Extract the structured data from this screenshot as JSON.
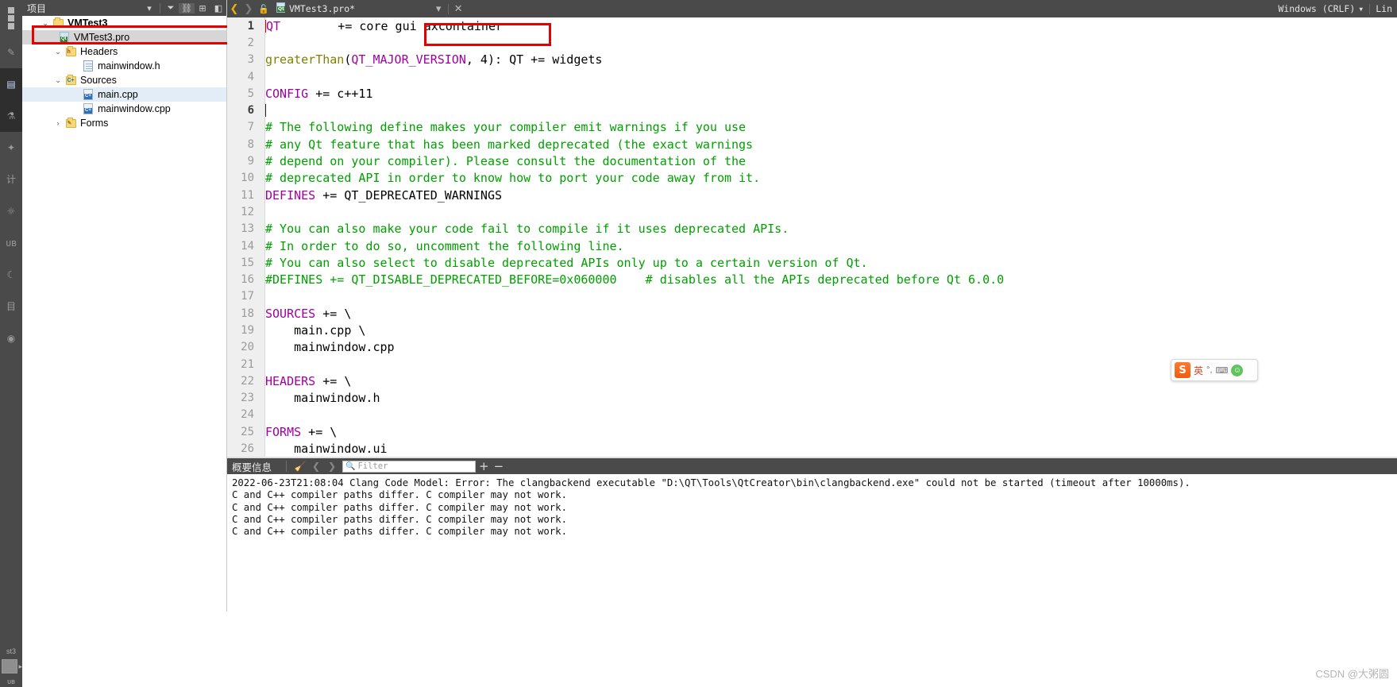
{
  "rail": {
    "items": [
      {
        "name": "welcome",
        "glyph": "▦"
      },
      {
        "name": "edit",
        "glyph": "✎"
      },
      {
        "name": "design",
        "glyph": "◧",
        "active": true
      },
      {
        "name": "debug",
        "glyph": "⚙"
      },
      {
        "name": "projects",
        "glyph": "✦"
      },
      {
        "name": "help",
        "glyph": "计"
      },
      {
        "name": "settings",
        "glyph": "☼"
      },
      {
        "name": "ue",
        "glyph": "ᴜʙ"
      },
      {
        "name": "run",
        "glyph": "☾"
      },
      {
        "name": "project2",
        "glyph": "目"
      },
      {
        "name": "build",
        "glyph": "◉"
      }
    ],
    "bottom_label": "st3",
    "bottom_label2": "ᴜʙ"
  },
  "sidebar": {
    "title": "项目",
    "header_buttons": [
      "▼",
      "filter-icon",
      "link-icon",
      "split-icon"
    ],
    "tree": [
      {
        "label": "VMTest3",
        "icon": "folder",
        "depth": 0,
        "expanded": true,
        "bold": true,
        "selected": false
      },
      {
        "label": "VMTest3.pro",
        "icon": "pro-file",
        "depth": 1,
        "expanded": null,
        "bold": false,
        "selected": "gray"
      },
      {
        "label": "Headers",
        "icon": "folder-h",
        "depth": 1,
        "expanded": true,
        "bold": false,
        "selected": false
      },
      {
        "label": "mainwindow.h",
        "icon": "note",
        "depth": 2,
        "expanded": null,
        "bold": false,
        "selected": false
      },
      {
        "label": "Sources",
        "icon": "folder-cpp",
        "depth": 1,
        "expanded": true,
        "bold": false,
        "selected": false
      },
      {
        "label": "main.cpp",
        "icon": "cpp-file",
        "depth": 2,
        "expanded": null,
        "bold": false,
        "selected": "blue"
      },
      {
        "label": "mainwindow.cpp",
        "icon": "cpp-file",
        "depth": 2,
        "expanded": null,
        "bold": false,
        "selected": false
      },
      {
        "label": "Forms",
        "icon": "folder-form",
        "depth": 1,
        "expanded": false,
        "bold": false,
        "selected": false
      }
    ]
  },
  "editor": {
    "tabbar": {
      "back": "❮",
      "forward": "❯",
      "lock": "lock-open-icon",
      "filename": "VMTest3.pro*",
      "dropdown": "▾",
      "close": "✕",
      "line_ending": "Windows (CRLF)",
      "line_ending_caret": "▾",
      "encoding": "Lin"
    },
    "lines": [
      {
        "n": 1,
        "current": true,
        "segments": [
          {
            "t": "QT",
            "c": "var"
          },
          {
            "t": "        += core gui ",
            "c": "plain"
          },
          {
            "t": "axcontainer",
            "c": "plain"
          }
        ]
      },
      {
        "n": 2,
        "current": false,
        "segments": []
      },
      {
        "n": 3,
        "current": false,
        "segments": [
          {
            "t": "greaterThan",
            "c": "fn"
          },
          {
            "t": "(",
            "c": "plain"
          },
          {
            "t": "QT_MAJOR_VERSION",
            "c": "var"
          },
          {
            "t": ", 4): ",
            "c": "plain"
          },
          {
            "t": "QT",
            "c": "plain"
          },
          {
            "t": " += widgets",
            "c": "plain"
          }
        ]
      },
      {
        "n": 4,
        "current": false,
        "segments": []
      },
      {
        "n": 5,
        "current": false,
        "segments": [
          {
            "t": "CONFIG",
            "c": "var"
          },
          {
            "t": " += c++11",
            "c": "plain"
          }
        ]
      },
      {
        "n": 6,
        "current": true,
        "segments": []
      },
      {
        "n": 7,
        "current": false,
        "segments": [
          {
            "t": "# The following define makes your compiler emit warnings if you use",
            "c": "cmt"
          }
        ]
      },
      {
        "n": 8,
        "current": false,
        "segments": [
          {
            "t": "# any Qt feature that has been marked deprecated (the exact warnings",
            "c": "cmt"
          }
        ]
      },
      {
        "n": 9,
        "current": false,
        "segments": [
          {
            "t": "# depend on your compiler). Please consult the documentation of the",
            "c": "cmt"
          }
        ]
      },
      {
        "n": 10,
        "current": false,
        "segments": [
          {
            "t": "# deprecated API in order to know how to port your code away from it.",
            "c": "cmt"
          }
        ]
      },
      {
        "n": 11,
        "current": false,
        "segments": [
          {
            "t": "DEFINES",
            "c": "var"
          },
          {
            "t": " += QT_DEPRECATED_WARNINGS",
            "c": "plain"
          }
        ]
      },
      {
        "n": 12,
        "current": false,
        "segments": []
      },
      {
        "n": 13,
        "current": false,
        "segments": [
          {
            "t": "# You can also make your code fail to compile if it uses deprecated APIs.",
            "c": "cmt"
          }
        ]
      },
      {
        "n": 14,
        "current": false,
        "segments": [
          {
            "t": "# In order to do so, uncomment the following line.",
            "c": "cmt"
          }
        ]
      },
      {
        "n": 15,
        "current": false,
        "segments": [
          {
            "t": "# You can also select to disable deprecated APIs only up to a certain version of Qt.",
            "c": "cmt"
          }
        ]
      },
      {
        "n": 16,
        "current": false,
        "segments": [
          {
            "t": "#DEFINES += QT_DISABLE_DEPRECATED_BEFORE=0x060000    # disables all the APIs deprecated before Qt 6.0.0",
            "c": "cmt"
          }
        ]
      },
      {
        "n": 17,
        "current": false,
        "segments": []
      },
      {
        "n": 18,
        "current": false,
        "segments": [
          {
            "t": "SOURCES",
            "c": "var"
          },
          {
            "t": " += \\",
            "c": "plain"
          }
        ]
      },
      {
        "n": 19,
        "current": false,
        "segments": [
          {
            "t": "    main.cpp \\",
            "c": "plain"
          }
        ]
      },
      {
        "n": 20,
        "current": false,
        "segments": [
          {
            "t": "    mainwindow.cpp",
            "c": "plain"
          }
        ]
      },
      {
        "n": 21,
        "current": false,
        "segments": []
      },
      {
        "n": 22,
        "current": false,
        "segments": [
          {
            "t": "HEADERS",
            "c": "var"
          },
          {
            "t": " += \\",
            "c": "plain"
          }
        ]
      },
      {
        "n": 23,
        "current": false,
        "segments": [
          {
            "t": "    mainwindow.h",
            "c": "plain"
          }
        ]
      },
      {
        "n": 24,
        "current": false,
        "segments": []
      },
      {
        "n": 25,
        "current": false,
        "segments": [
          {
            "t": "FORMS",
            "c": "var"
          },
          {
            "t": " += \\",
            "c": "plain"
          }
        ]
      },
      {
        "n": 26,
        "current": false,
        "segments": [
          {
            "t": "    mainwindow.ui",
            "c": "plain"
          }
        ]
      }
    ],
    "highlight_word": "axcontainer",
    "highlight_color": "#e60000"
  },
  "output": {
    "title": "概要信息",
    "toolbar": {
      "clean_icon": "broom-icon",
      "prev": "❮",
      "next": "❯",
      "plus": "+",
      "minus": "−"
    },
    "filter": {
      "placeholder": "Filter",
      "value": "",
      "icon": "search-icon"
    },
    "lines": [
      "2022-06-23T21:08:04 Clang Code Model: Error: The clangbackend executable \"D:\\QT\\Tools\\QtCreator\\bin\\clangbackend.exe\" could not be started (timeout after 10000ms).",
      "C and C++ compiler paths differ. C compiler may not work.",
      "C and C++ compiler paths differ. C compiler may not work.",
      "C and C++ compiler paths differ. C compiler may not work.",
      "C and C++ compiler paths differ. C compiler may not work."
    ]
  },
  "ime": {
    "logo": "S",
    "label": "英",
    "mode_icon": "°,",
    "keyboard_icon": "⌨",
    "face_icon": "☺"
  },
  "watermark": "CSDN @大粥圆"
}
